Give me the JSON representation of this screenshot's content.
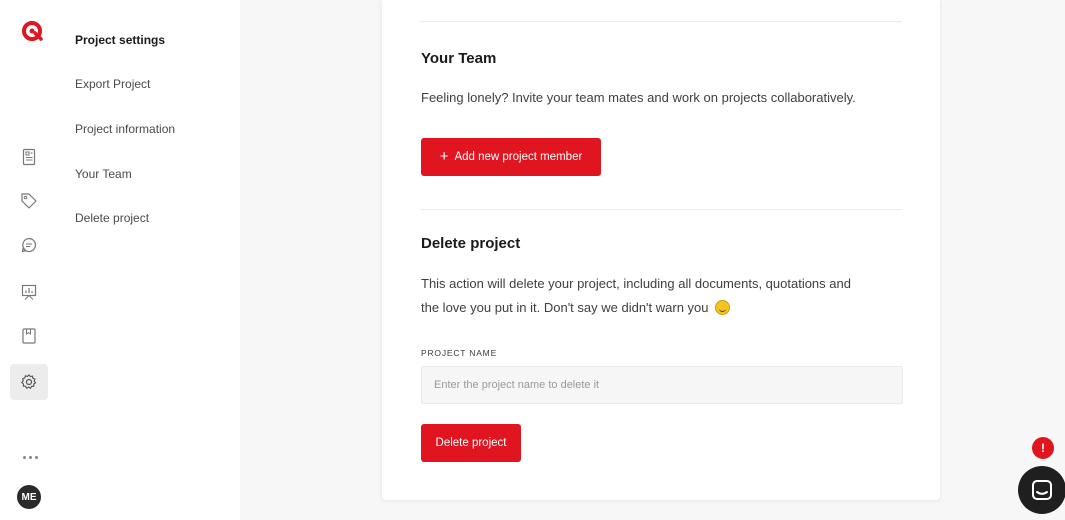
{
  "rail": {
    "avatar_initials": "ME",
    "icons": [
      "logo-icon",
      "document-icon",
      "tag-icon",
      "comment-icon",
      "presentation-chart-icon",
      "book-icon",
      "gear-icon",
      "more-icon"
    ]
  },
  "subnav": {
    "items": [
      {
        "label": "Project settings",
        "active": true
      },
      {
        "label": "Export Project"
      },
      {
        "label": "Project information"
      },
      {
        "label": "Your Team"
      },
      {
        "label": "Delete project"
      }
    ]
  },
  "team": {
    "title": "Your Team",
    "description": "Feeling lonely? Invite your team mates and work on projects collaboratively.",
    "add_button_icon": "+",
    "add_button_label": "Add new project member"
  },
  "delete": {
    "title": "Delete project",
    "description_line1": "This action will delete your project, including all documents, quotations and",
    "description_line2": "the love you put in it. Don't say we didn't warn you",
    "field_label": "PROJECT NAME",
    "input_placeholder": "Enter the project name to delete it",
    "input_value": "",
    "button_label": "Delete project"
  },
  "chat": {
    "alert_badge": "!"
  },
  "colors": {
    "accent": "#e0151f",
    "rail_active_bg": "#ececec",
    "page_bg": "#f7f7f7"
  }
}
